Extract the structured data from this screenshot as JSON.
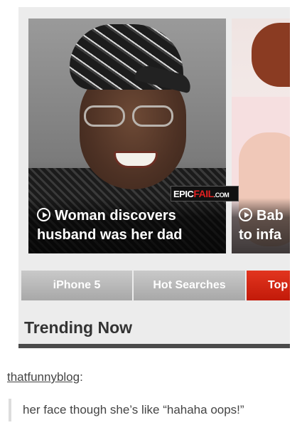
{
  "carousel": {
    "slides": [
      {
        "caption_line1": "Woman discovers",
        "caption_line2": "husband was her dad",
        "icon": "play-circle-icon"
      },
      {
        "caption_line1": "Bab",
        "caption_line2": "to infa",
        "icon": "play-circle-icon"
      }
    ]
  },
  "watermark": {
    "epic": "EPIC",
    "fail": "FAIL",
    "com": ".COM"
  },
  "tabs": [
    "iPhone 5",
    "Hot Searches",
    "Top"
  ],
  "section": {
    "title": "Trending Now"
  },
  "post": {
    "author": "thatfunnyblog",
    "colon": ":",
    "quote": "her face though she’s like “hahaha oops!”"
  },
  "colors": {
    "tab_active": "#d3230f",
    "tab": "#b8b8b8",
    "rule": "#4a4a4a"
  }
}
